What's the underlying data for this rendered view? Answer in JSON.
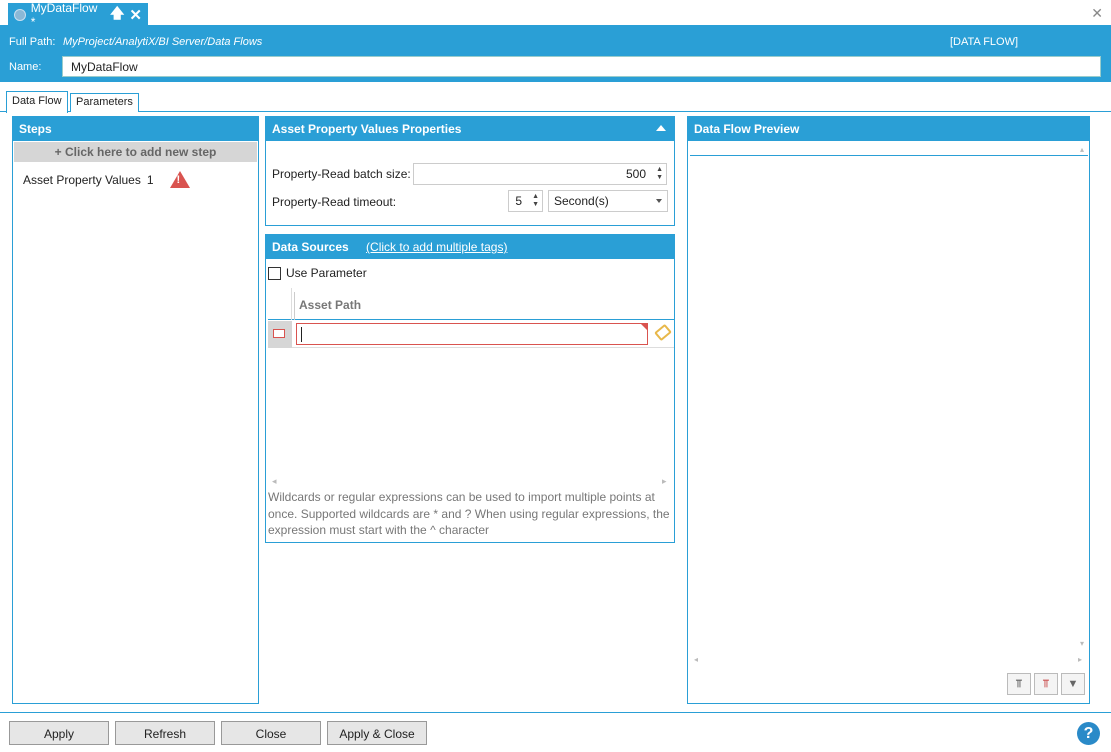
{
  "title_bar": {
    "tab_label": "MyDataFlow *",
    "tab_icon": "data-flow-icon",
    "pin_glyph": "🡅",
    "close_glyph": "✕",
    "window_close_glyph": "✕"
  },
  "header": {
    "full_path_label": "Full Path:",
    "full_path_value": "MyProject/AnalytiX/BI Server/Data Flows",
    "type_label": "[DATA FLOW]",
    "name_label": "Name:",
    "name_value": "MyDataFlow"
  },
  "tabs": [
    {
      "label": "Data Flow",
      "active": true
    },
    {
      "label": "Parameters",
      "active": false
    }
  ],
  "steps": {
    "title": "Steps",
    "add_label": "+  Click here to add new step",
    "items": [
      {
        "label": "Asset Property Values",
        "count": "1",
        "status": "warning-icon",
        "warn_glyph": "!"
      }
    ]
  },
  "properties": {
    "title": "Asset Property Values Properties",
    "batch_size_label": "Property-Read batch size:",
    "batch_size_value": "500",
    "timeout_label": "Property-Read timeout:",
    "timeout_value": "5",
    "timeout_unit": "Second(s)",
    "spin_glyph": "▲\n▼"
  },
  "data_sources": {
    "title": "Data Sources",
    "link_label": "(Click to add multiple tags)",
    "use_parameter_label": "Use Parameter",
    "column_header": "Asset Path",
    "hint": "Wildcards or regular expressions can be used to import multiple points at once. Supported wildcards are * and ? When using regular expressions, the expression must start with the ^ character",
    "scroll_left": "◂",
    "scroll_right": "▸"
  },
  "preview": {
    "title": "Data Flow Preview",
    "scroll_up": "▴",
    "scroll_down": "▾",
    "scroll_left": "◂",
    "scroll_right": "▸",
    "tools": [
      {
        "icon": "add-column-filter-icon",
        "glyph": "⫪"
      },
      {
        "icon": "remove-column-filter-icon",
        "glyph": "⫪"
      },
      {
        "icon": "filter-icon",
        "glyph": "▼"
      }
    ]
  },
  "footer": {
    "apply": "Apply",
    "refresh": "Refresh",
    "close": "Close",
    "apply_close": "Apply & Close",
    "help_glyph": "?"
  },
  "colors": {
    "accent": "#2a9fd6",
    "error": "#d9534f"
  }
}
